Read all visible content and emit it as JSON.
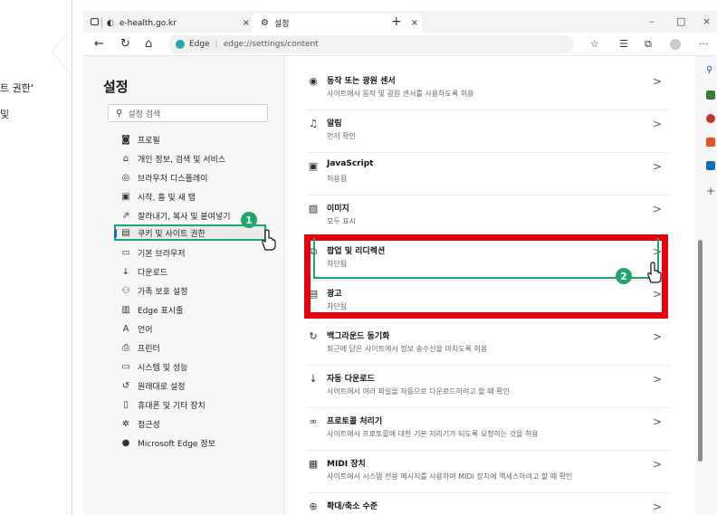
{
  "doc": {
    "line1": "트 권한'",
    "line2": "및"
  },
  "browser": {
    "tabs": [
      {
        "label": "e-health.go.kr",
        "close": "×"
      },
      {
        "label": "설정",
        "close": "×"
      }
    ],
    "new_tab": "+",
    "window_controls": {
      "minimize": "–",
      "maximize": "□",
      "close": "×"
    },
    "address": {
      "site_label": "Edge",
      "url": "edge://settings/content"
    },
    "toolbar_more": "···"
  },
  "sidebar": {
    "title": "설정",
    "search_placeholder": "설정 검색",
    "items": [
      {
        "label": "프로필",
        "icon": "profile-icon"
      },
      {
        "label": "개인 정보, 검색 및 서비스",
        "icon": "lock-icon"
      },
      {
        "label": "브라우저 디스플레이",
        "icon": "palette-icon"
      },
      {
        "label": "시작, 홈 및 새 탭",
        "icon": "home-icon"
      },
      {
        "label": "잘라내기, 복사 및 붙여넣기",
        "icon": "share-icon"
      },
      {
        "label": "쿠키 및 사이트 권한",
        "icon": "cookie-icon"
      },
      {
        "label": "기본 브라우저",
        "icon": "browser-icon"
      },
      {
        "label": "다운로드",
        "icon": "download-icon"
      },
      {
        "label": "가족 보호 설정",
        "icon": "family-icon"
      },
      {
        "label": "Edge 표시줄",
        "icon": "edge-bar-icon"
      },
      {
        "label": "언어",
        "icon": "language-icon"
      },
      {
        "label": "프린터",
        "icon": "printer-icon"
      },
      {
        "label": "시스템 및 성능",
        "icon": "system-icon"
      },
      {
        "label": "원래대로 설정",
        "icon": "reset-icon"
      },
      {
        "label": "휴대폰 및 기타 장치",
        "icon": "phone-icon"
      },
      {
        "label": "접근성",
        "icon": "accessibility-icon"
      },
      {
        "label": "Microsoft Edge 정보",
        "icon": "edge-logo-icon"
      }
    ]
  },
  "content": {
    "rows": [
      {
        "title": "동작 또는 광원 센서",
        "desc": "사이트에서 동작 및 광원 센서를 사용하도록 허용",
        "icon": "sensor-icon"
      },
      {
        "title": "알림",
        "desc": "먼저 확인",
        "icon": "bell-icon"
      },
      {
        "title": "JavaScript",
        "desc": "허용됨",
        "icon": "javascript-icon"
      },
      {
        "title": "이미지",
        "desc": "모두 표시",
        "icon": "image-icon"
      },
      {
        "title": "팝업 및 리디렉션",
        "desc": "차단됨",
        "icon": "popup-icon"
      },
      {
        "title": "광고",
        "desc": "차단됨",
        "icon": "ads-icon"
      },
      {
        "title": "백그라운드 동기화",
        "desc": "최근에 닫은 사이트에서 정보 송수신을 마치도록 허용",
        "icon": "sync-icon"
      },
      {
        "title": "자동 다운로드",
        "desc": "사이트에서 여러 파일을 자동으로 다운로드하려고 할 때 확인",
        "icon": "download-icon"
      },
      {
        "title": "프로토콜 처리기",
        "desc": "사이트에서 프로토콜에 대한 기본 처리기가 되도록 요청하는 것을 허용",
        "icon": "protocol-icon"
      },
      {
        "title": "MIDI 장치",
        "desc": "사이트에서 시스템 전용 메시지를 사용하여 MIDI 장치에 액세스하려고 할 때 확인",
        "icon": "midi-icon"
      },
      {
        "title": "확대/축소 수준",
        "desc": "",
        "icon": "zoom-icon"
      }
    ],
    "chevron": ">"
  },
  "annotations": {
    "badge1": "1",
    "badge2": "2",
    "accent_green": "#1fa66a",
    "accent_red": "#e8000c"
  }
}
